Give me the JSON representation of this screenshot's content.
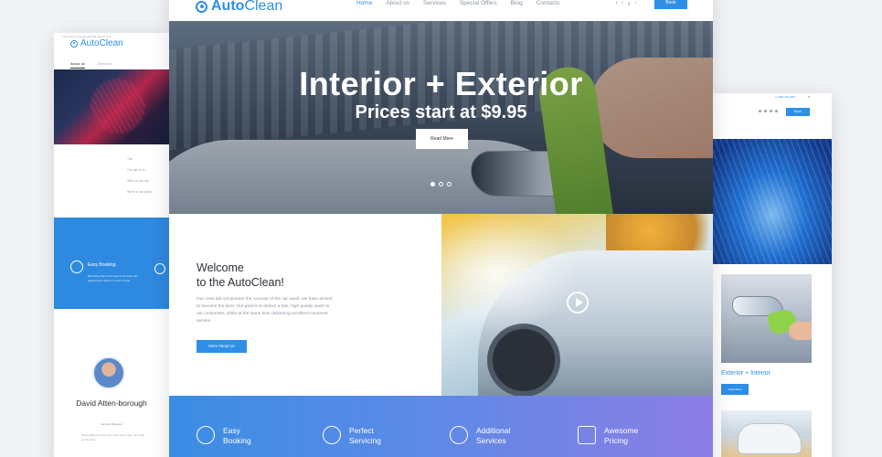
{
  "left_page": {
    "tiny_top": "Your dream of deep plowing cars is here",
    "logo": "AutoClean",
    "nav": [
      "About us",
      "Services"
    ],
    "text_lines": [
      "The",
      "Our aim is to...",
      "With us you are",
      "We're a car wash"
    ],
    "feature_title": "Easy Booking",
    "feature_text": "Best thing that you'll need to do have this appointment with us is just to book.",
    "person_name": "David Atten-borough",
    "person_role": "General Manager",
    "person_bio": "David started on this role a few years ago, then built up his team."
  },
  "right_page": {
    "phone": "+1 800 123 4567",
    "book_label": "Book",
    "card_title": "Exterior + Interior",
    "card_button": "Read More"
  },
  "main": {
    "brand_bold": "Auto",
    "brand_light": "Clean",
    "menu": [
      "Home",
      "About us",
      "Services",
      "Special Offers",
      "Blog",
      "Contacts"
    ],
    "active_menu": "Home",
    "social": [
      "f",
      "t",
      "g",
      "i"
    ],
    "book_label": "Book",
    "hero_title": "Interior + Exterior",
    "hero_subtitle": "Prices start at $9.95",
    "hero_button": "Read More",
    "welcome_title_1": "Welcome",
    "welcome_title_2": "to the AutoClean!",
    "welcome_text": "Our crew did not pioneer the concept of the car wash, we have strived to become the best. Our goal is to deliver a fast, high quality wash to our customers, while at the same time delivering excellent customer service.",
    "welcome_button": "More About Us",
    "features": [
      {
        "title_1": "Easy",
        "title_2": "Booking"
      },
      {
        "title_1": "Perfect",
        "title_2": "Servicing"
      },
      {
        "title_1": "Additional",
        "title_2": "Services"
      },
      {
        "title_1": "Awesome",
        "title_2": "Pricing"
      }
    ]
  },
  "colors": {
    "accent": "#2d8fe6",
    "feature_bar_start": "#3b8de4",
    "feature_bar_end": "#8c7ee4"
  }
}
